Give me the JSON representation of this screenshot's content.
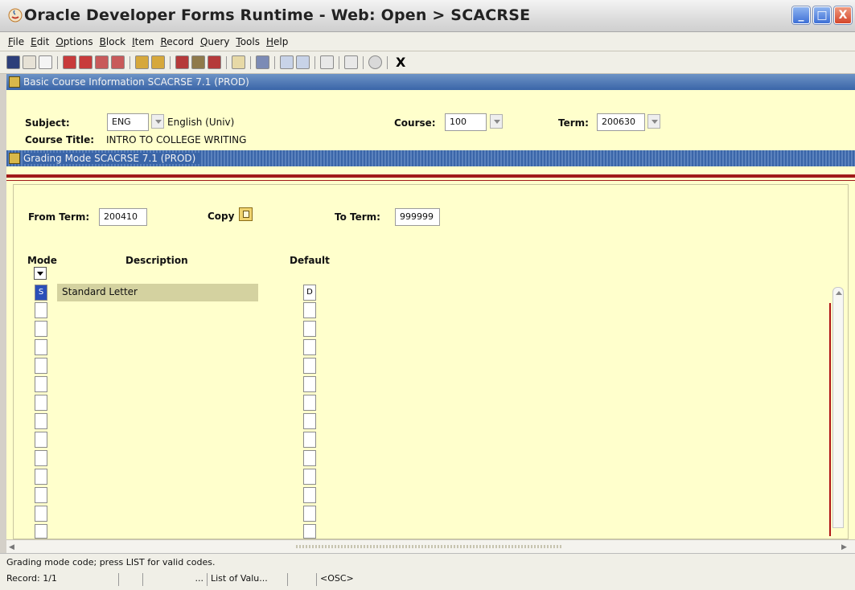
{
  "window": {
    "title": "Oracle Developer Forms Runtime - Web:  Open > SCACRSE",
    "controls": {
      "minimize": "_",
      "maximize": "□",
      "close": "X"
    }
  },
  "menu": [
    "File",
    "Edit",
    "Options",
    "Block",
    "Item",
    "Record",
    "Query",
    "Tools",
    "Help"
  ],
  "toolbar": {
    "exit_label": "X"
  },
  "key_block": {
    "header": "Basic Course Information  SCACRSE  7.1  (PROD)",
    "subject_label": "Subject:",
    "subject_value": "ENG",
    "subject_desc": "English (Univ)",
    "course_label": "Course:",
    "course_value": "100",
    "term_label": "Term:",
    "term_value": "200630",
    "course_title_label": "Course Title:",
    "course_title_value": "INTRO TO COLLEGE WRITING"
  },
  "grade_block": {
    "header": "Grading Mode  SCACRSE  7.1  (PROD)",
    "from_term_label": "From Term:",
    "from_term_value": "200410",
    "copy_label": "Copy",
    "to_term_label": "To Term:",
    "to_term_value": "999999",
    "columns": {
      "mode": "Mode",
      "description": "Description",
      "default": "Default"
    },
    "rows": [
      {
        "mode": "S",
        "description": "Standard Letter",
        "default": "D"
      }
    ]
  },
  "status": {
    "message": "Grading mode code; press LIST for valid codes.",
    "record": "Record: 1/1",
    "ellipsis": "...",
    "list_of_values": "List of Valu...",
    "osc": "<OSC>"
  }
}
